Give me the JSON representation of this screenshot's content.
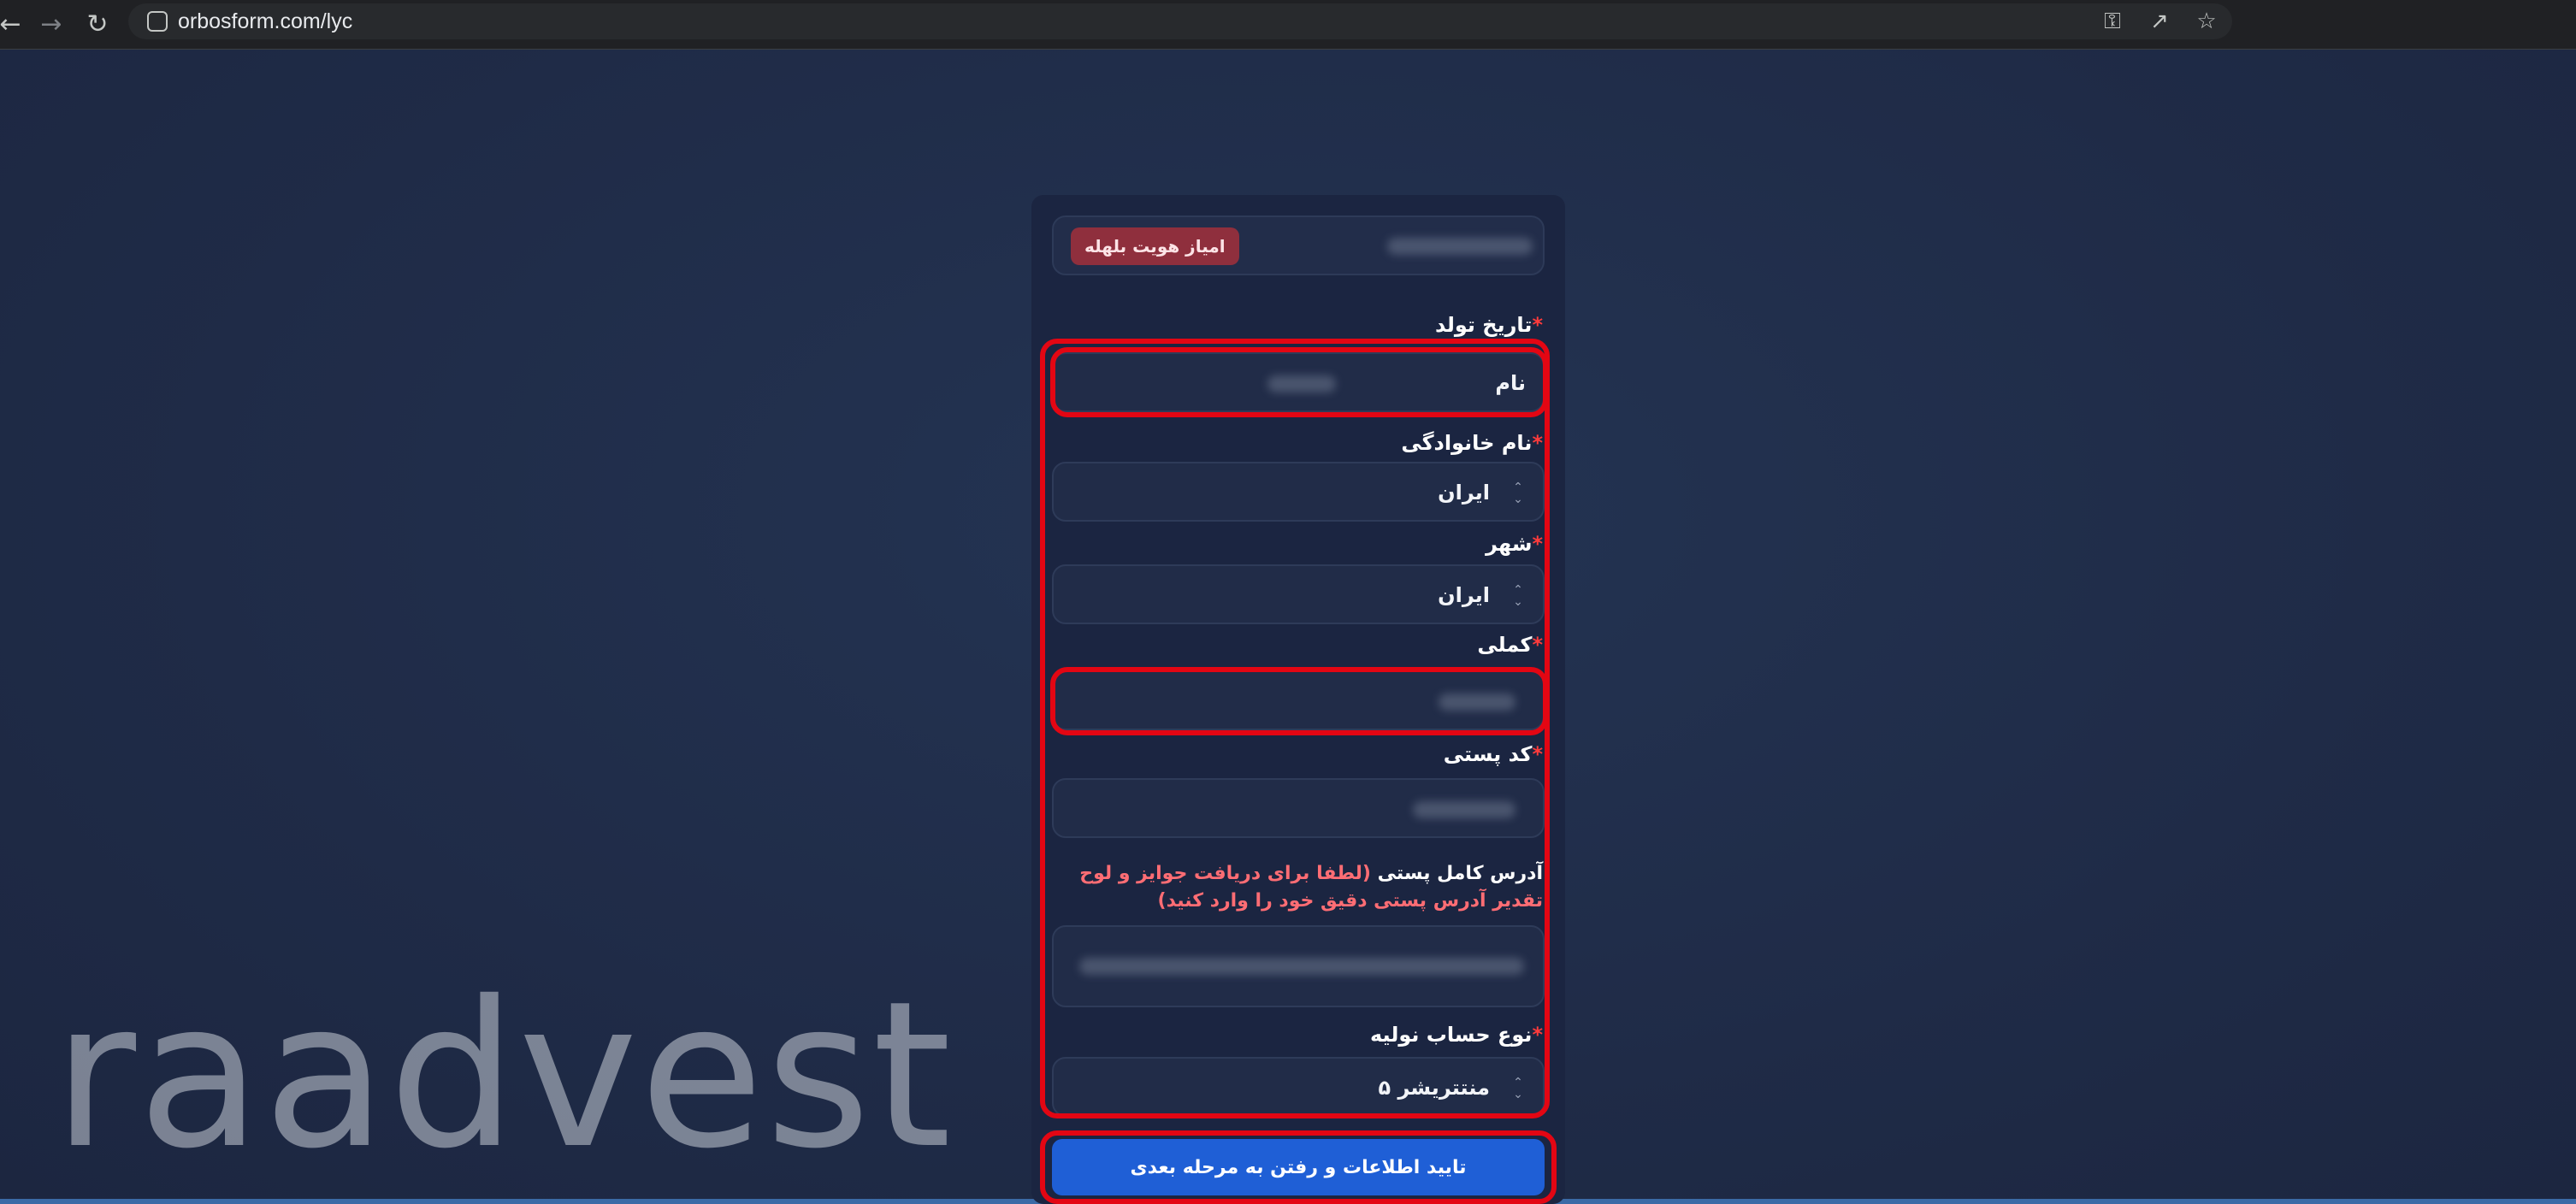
{
  "browser": {
    "url": "orbosform.com/lyc",
    "back_icon": "arrow-left-icon",
    "forward_icon": "arrow-right-icon",
    "reload_icon": "reload-icon"
  },
  "form": {
    "badge": "امیاز هویت بلهله",
    "birth_label": "تاریخ تولد",
    "first_name_value": "نام",
    "last_name_label": "نام خانوادگی",
    "country_value": "ایران",
    "city_label": "شهر",
    "city_value": "ایران",
    "national_label": "کملی",
    "postal_label": "کد پستی",
    "address_label": "آدرس کامل پستی",
    "address_hint": "(لطفا برای دریافت جوایز و لوح تقدیر آدرس پستی دقیق خود را وارد کنید)",
    "account_label": "نوع حساب نولیه",
    "account_value": "منتتریشر ۵",
    "required_mark": "*",
    "submit_label": "تایید اطلاعات و رفتن به مرحله بعدی"
  },
  "watermark": "raadvest",
  "colors": {
    "page_bg": "#1f2a44",
    "card_bg": "#1b2541",
    "accent": "#1f5fd6",
    "annotation": "#e30613",
    "badge": "#8f2f3d"
  }
}
